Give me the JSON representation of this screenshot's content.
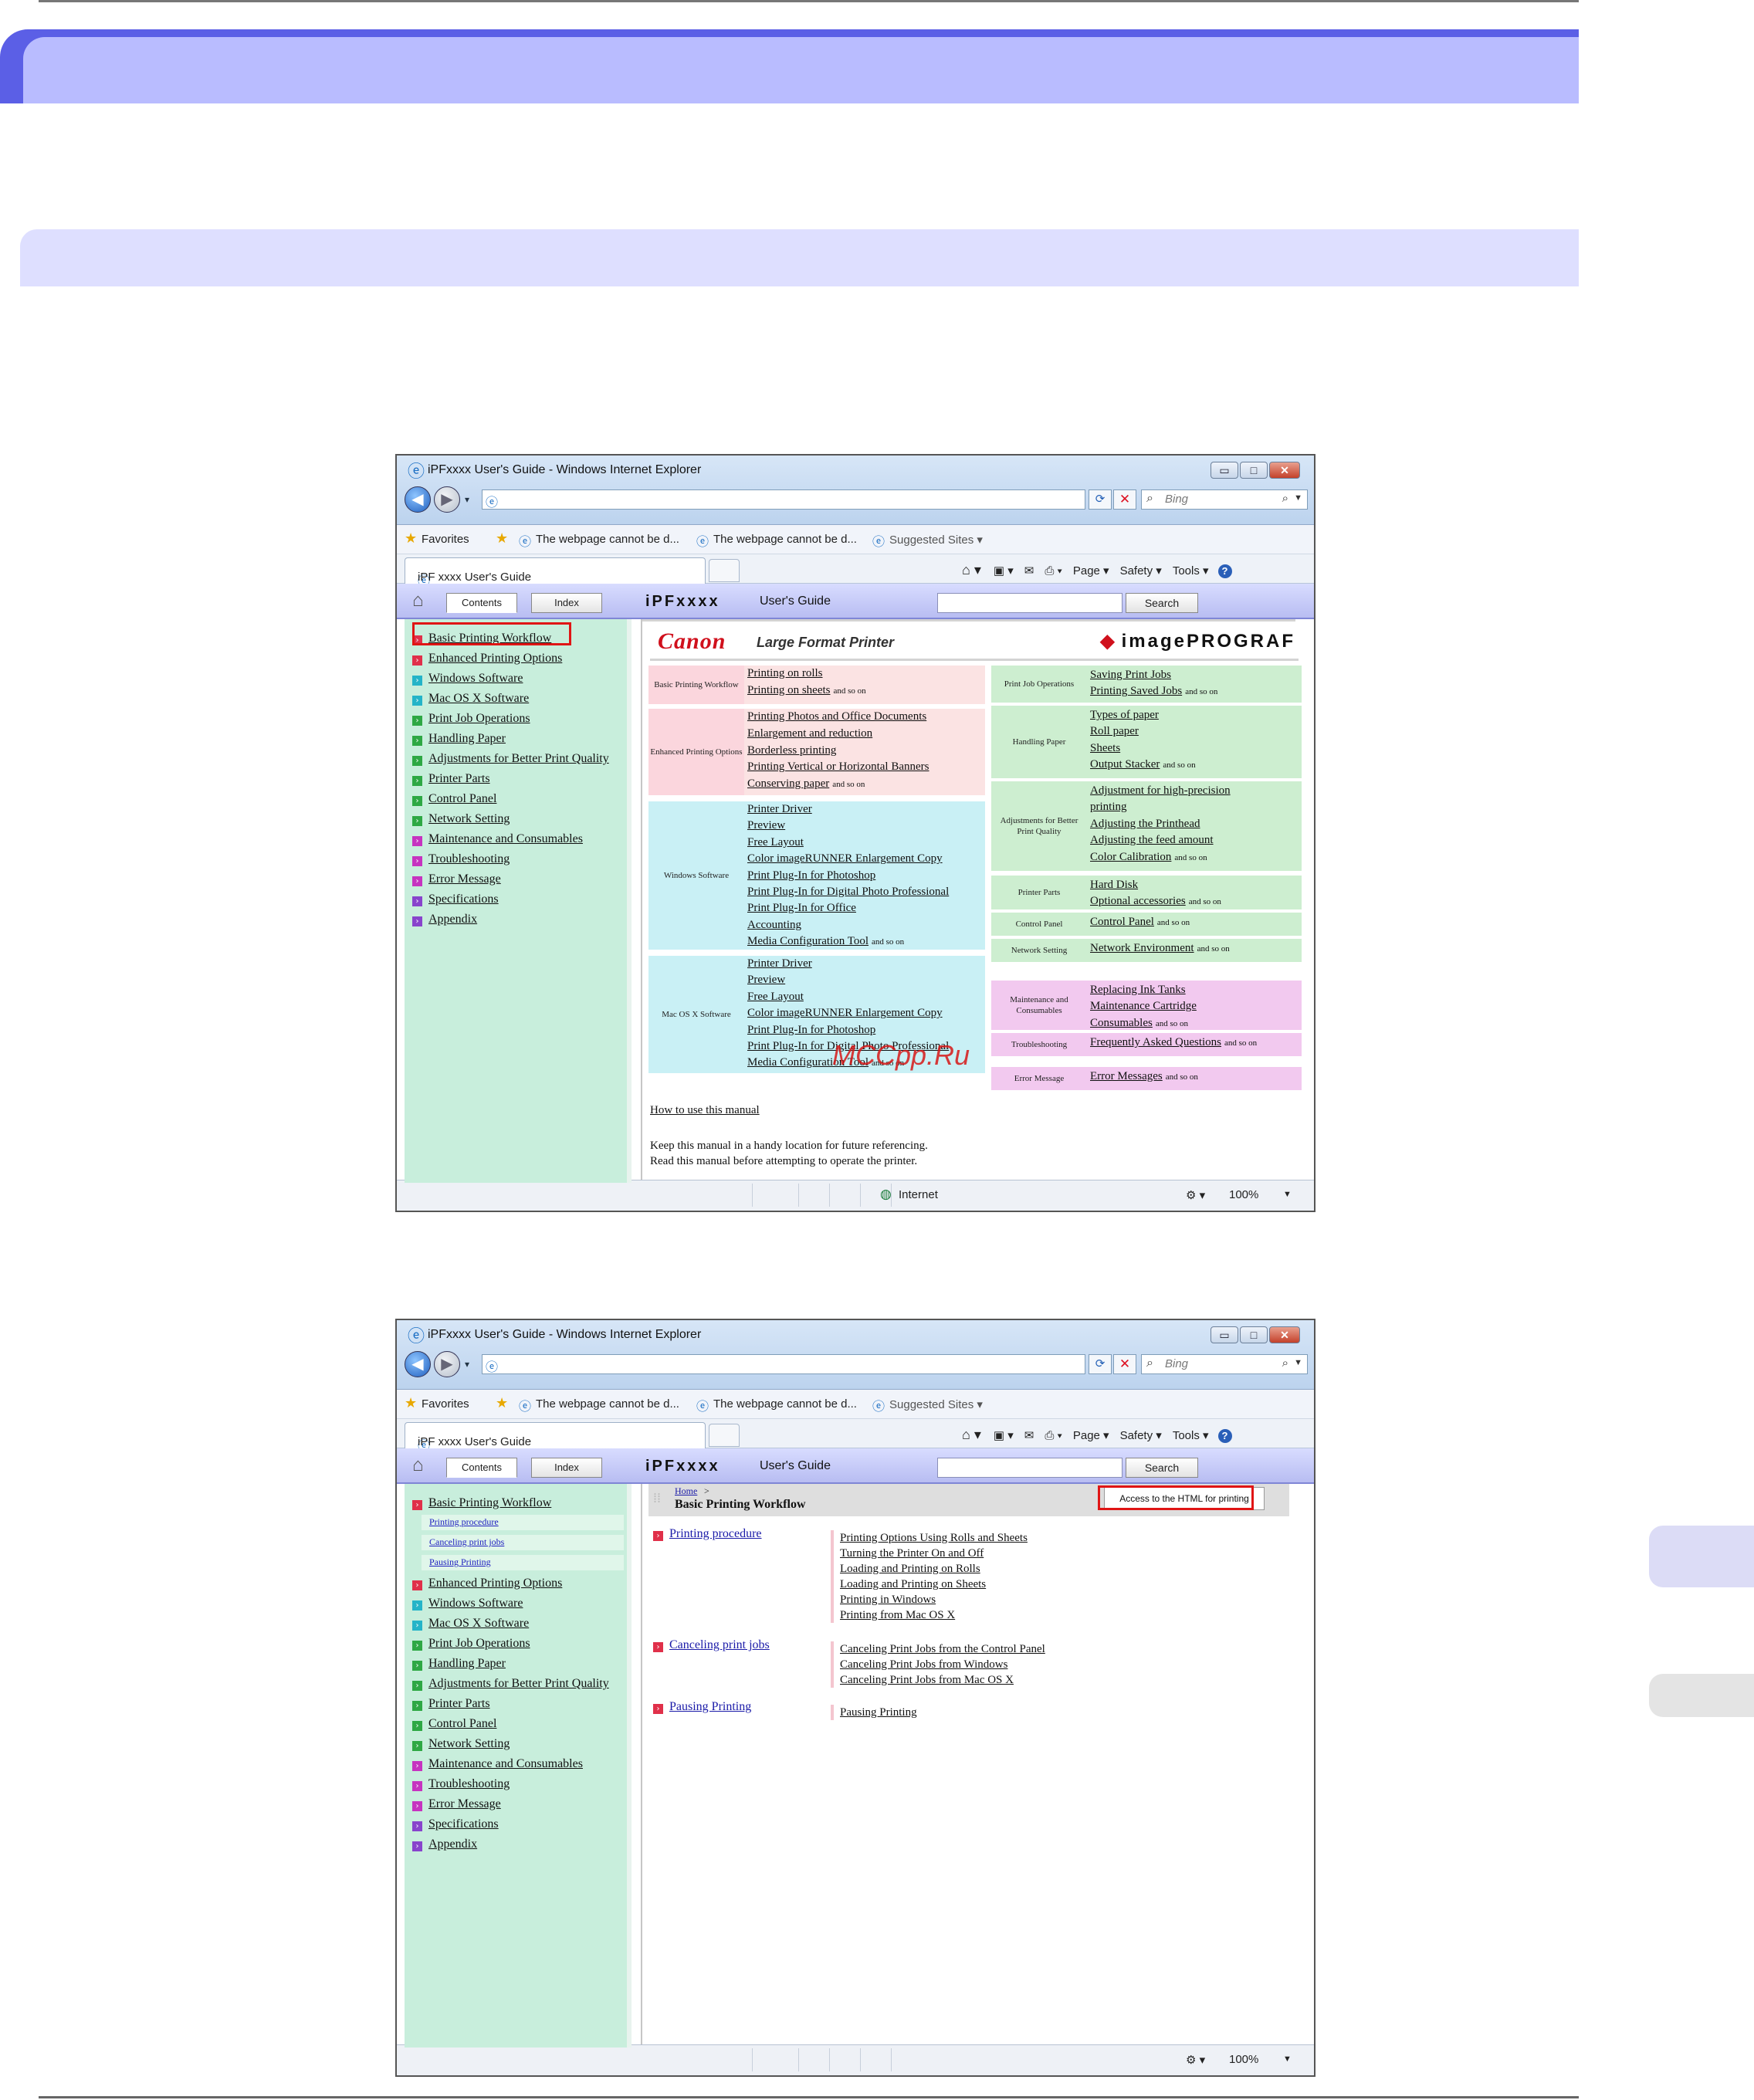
{
  "colors": {
    "pink": "#f4d9de",
    "salmon": "#fbe3e3",
    "cyan": "#c9f0f5",
    "green": "#cdeed0",
    "violet": "#f2c9ef",
    "sidebar": "#c8eedc",
    "accent": "#5b5fe6",
    "highlight": "#e01515"
  },
  "browser": {
    "title": "iPFxxxx  User's Guide - Windows Internet Explorer",
    "search_placeholder": "Bing",
    "favorites": "Favorites",
    "fav1": "The webpage cannot be d...",
    "fav2": "The webpage cannot be d...",
    "suggested": "Suggested Sites ▾",
    "tab": "iPF xxxx  User's Guide",
    "page_menu": "Page ▾",
    "safety_menu": "Safety ▾",
    "tools_menu": "Tools ▾",
    "zoom": "100%",
    "zone": "Internet"
  },
  "guide": {
    "contents_tab": "Contents",
    "index_tab": "Index",
    "title": "iPFxxxx",
    "subtitle": "User's Guide",
    "search_button": "Search"
  },
  "nav": [
    {
      "label": "Basic Printing Workflow",
      "color": "#e0304a"
    },
    {
      "label": "Enhanced Printing Options",
      "color": "#e0304a"
    },
    {
      "label": "Windows Software",
      "color": "#24b4c8"
    },
    {
      "label": "Mac OS X Software",
      "color": "#24b4c8"
    },
    {
      "label": "Print Job Operations",
      "color": "#2ea844"
    },
    {
      "label": "Handling Paper",
      "color": "#2ea844"
    },
    {
      "label": "Adjustments for Better Print Quality",
      "color": "#2ea844"
    },
    {
      "label": "Printer Parts",
      "color": "#2ea844"
    },
    {
      "label": "Control Panel",
      "color": "#2ea844"
    },
    {
      "label": "Network Setting",
      "color": "#2ea844"
    },
    {
      "label": "Maintenance and Consumables",
      "color": "#c633c0"
    },
    {
      "label": "Troubleshooting",
      "color": "#c633c0"
    },
    {
      "label": "Error Message",
      "color": "#c633c0"
    },
    {
      "label": "Specifications",
      "color": "#8844cc"
    },
    {
      "label": "Appendix",
      "color": "#8844cc"
    }
  ],
  "subnav": [
    "Printing procedure",
    "Canceling print jobs",
    "Pausing Printing"
  ],
  "brand": {
    "canon": "Canon",
    "tagline": "Large Format Printer",
    "product": "imagePROGRAF"
  },
  "andso": "and so on",
  "cats_left": [
    {
      "label": "Basic Printing Workflow",
      "links": [
        "Printing on rolls",
        "Printing on sheets"
      ]
    },
    {
      "label": "Enhanced Printing Options",
      "links": [
        "Printing Photos and Office Documents",
        "Enlargement and reduction",
        "Borderless printing",
        "Printing Vertical or Horizontal Banners",
        "Conserving paper"
      ]
    },
    {
      "label": "Windows Software",
      "links": [
        "Printer Driver",
        "Preview",
        "Free Layout",
        "Color imageRUNNER Enlargement Copy",
        "Print Plug-In for Photoshop",
        "Print Plug-In for Digital Photo Professional",
        "Print Plug-In for Office",
        "Accounting",
        "Media Configuration Tool"
      ]
    },
    {
      "label": "Mac OS X Software",
      "links": [
        "Printer Driver",
        "Preview",
        "Free Layout",
        "Color imageRUNNER Enlargement Copy",
        "Print Plug-In for Photoshop",
        "Print Plug-In for Digital Photo Professional",
        "Media Configuration Tool"
      ]
    }
  ],
  "cats_right": [
    {
      "label": "Print Job Operations",
      "links": [
        "Saving Print Jobs",
        "Printing Saved Jobs"
      ]
    },
    {
      "label": "Handling Paper",
      "links": [
        "Types of paper",
        "Roll paper",
        "Sheets",
        "Output Stacker"
      ]
    },
    {
      "label": "Adjustments for Better Print Quality",
      "links": [
        "Adjustment for high-precision",
        "printing",
        "Adjusting the Printhead",
        "Adjusting the feed amount",
        "Color Calibration"
      ]
    },
    {
      "label": "Printer Parts",
      "links": [
        "Hard Disk",
        "Optional accessories"
      ]
    },
    {
      "label": "Control Panel",
      "links": [
        "Control Panel"
      ]
    },
    {
      "label": "Network Setting",
      "links": [
        "Network Environment"
      ]
    },
    {
      "label": "Maintenance and Consumables",
      "links": [
        "Replacing Ink Tanks",
        "Maintenance Cartridge",
        "Consumables"
      ]
    },
    {
      "label": "Troubleshooting",
      "links": [
        "Frequently Asked Questions"
      ]
    },
    {
      "label": "Error Message",
      "links": [
        "Error Messages"
      ]
    }
  ],
  "howto": "How to use this manual",
  "intro1": "Keep this manual in a handy location for future referencing.",
  "intro2": "Read this manual before attempting to operate the printer.",
  "watermark": "MCCpp.Ru",
  "breadcrumb": {
    "home": "Home",
    "sep": ">",
    "title": "Basic Printing Workflow",
    "print": "Access to the HTML for printing"
  },
  "procedures": [
    {
      "label": "Printing procedure",
      "items": [
        "Printing Options Using Rolls and Sheets",
        "Turning the Printer On and Off",
        "Loading and Printing on Rolls",
        "Loading and Printing on Sheets",
        "Printing in Windows",
        "Printing from Mac OS X"
      ]
    },
    {
      "label": "Canceling print jobs",
      "items": [
        "Canceling Print Jobs from the Control Panel",
        "Canceling Print Jobs from Windows",
        "Canceling Print Jobs from Mac OS X"
      ]
    },
    {
      "label": "Pausing Printing",
      "items": [
        "Pausing Printing"
      ]
    }
  ]
}
